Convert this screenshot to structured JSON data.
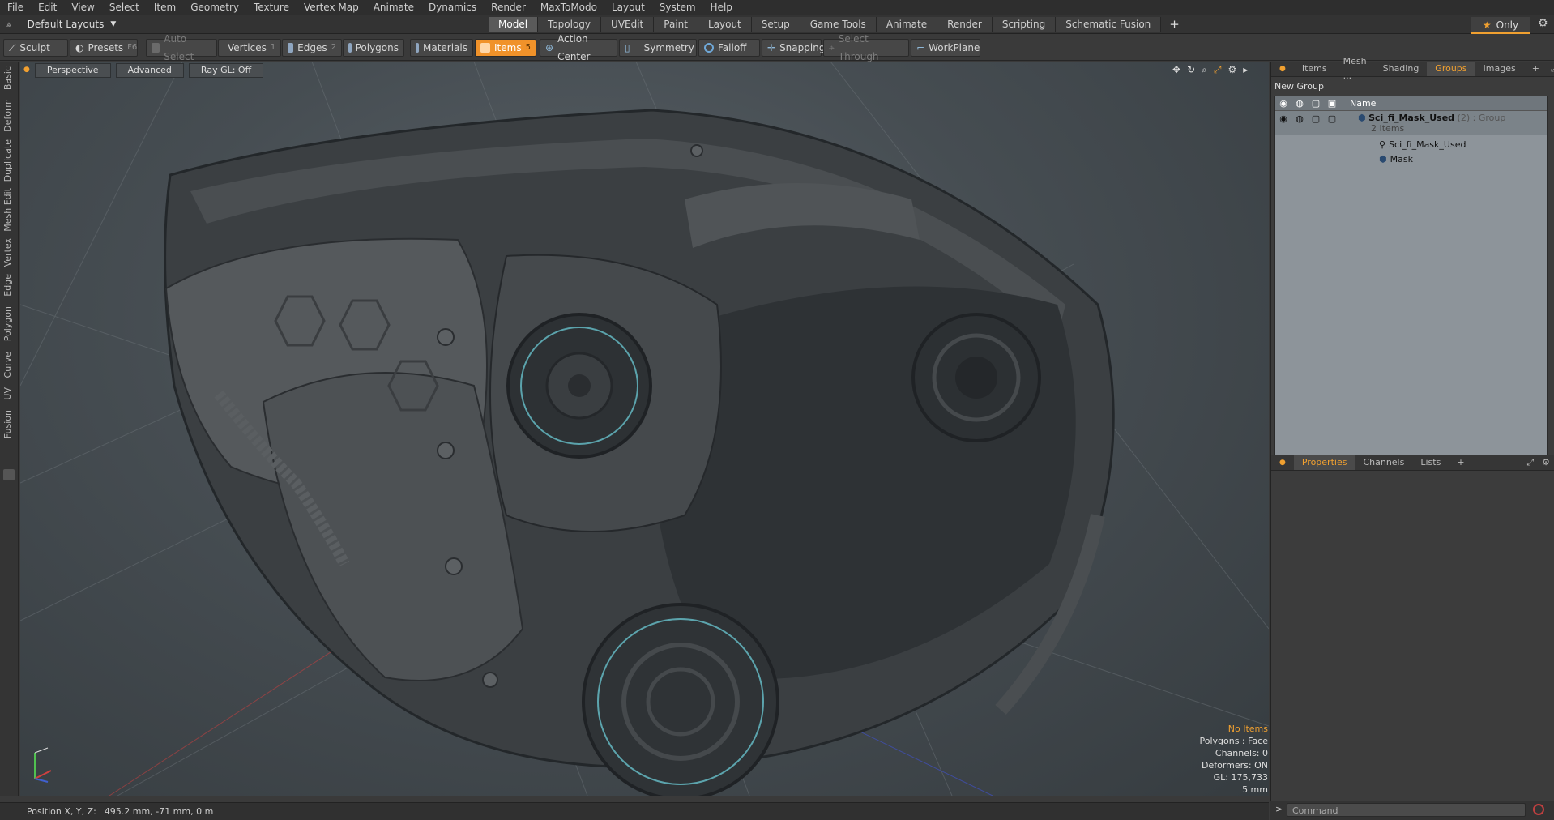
{
  "menu": [
    "File",
    "Edit",
    "View",
    "Select",
    "Item",
    "Geometry",
    "Texture",
    "Vertex Map",
    "Animate",
    "Dynamics",
    "Render",
    "MaxToModo",
    "Layout",
    "System",
    "Help"
  ],
  "layout_selector": "Default Layouts",
  "layout_tabs": [
    "Model",
    "Topology",
    "UVEdit",
    "Paint",
    "Layout",
    "Setup",
    "Game Tools",
    "Animate",
    "Render",
    "Scripting",
    "Schematic Fusion"
  ],
  "active_layout_tab": "Model",
  "only_label": "Only",
  "toolbar": {
    "sculpt": "Sculpt",
    "presets": "Presets",
    "presets_key": "F6",
    "auto_select": "Auto Select",
    "vertices": "Vertices",
    "vertices_count": "1",
    "edges": "Edges",
    "edges_count": "2",
    "polygons": "Polygons",
    "materials": "Materials",
    "items": "Items",
    "items_count": "5",
    "action_center": "Action Center",
    "symmetry": "Symmetry",
    "falloff": "Falloff",
    "snapping": "Snapping",
    "select_through": "Select Through",
    "workplane": "WorkPlane"
  },
  "left_tabs": [
    "Basic",
    "Deform",
    "Duplicate",
    "Mesh Edit",
    "Vertex",
    "Edge",
    "Polygon",
    "Curve",
    "UV",
    "Fusion"
  ],
  "viewport": {
    "perspective": "Perspective",
    "advanced": "Advanced",
    "raygl": "Ray GL: Off"
  },
  "info": {
    "selection": "No Items",
    "polygons": "Polygons : Face",
    "channels": "Channels: 0",
    "deformers": "Deformers: ON",
    "gl": "GL: 175,733",
    "scale": "5 mm"
  },
  "status": {
    "label": "Position X, Y, Z:",
    "value": "495.2 mm, -71 mm, 0 m"
  },
  "right_tabs": [
    "Items",
    "Mesh ...",
    "Shading",
    "Groups",
    "Images"
  ],
  "active_right_tab": "Groups",
  "new_group": "New Group",
  "groups_header": "Name",
  "groups": {
    "root_name": "Sci_fi_Mask_Used",
    "root_count": "(2)",
    "root_type": ": Group",
    "root_sub": "2 Items",
    "children": [
      "Sci_fi_Mask_Used",
      "Mask"
    ]
  },
  "prop_tabs": [
    "Properties",
    "Channels",
    "Lists"
  ],
  "command_placeholder": "Command",
  "colors": {
    "accent": "#f0922a",
    "panel": "#3c3c3c",
    "ring_glow": "#6fd4e0"
  }
}
